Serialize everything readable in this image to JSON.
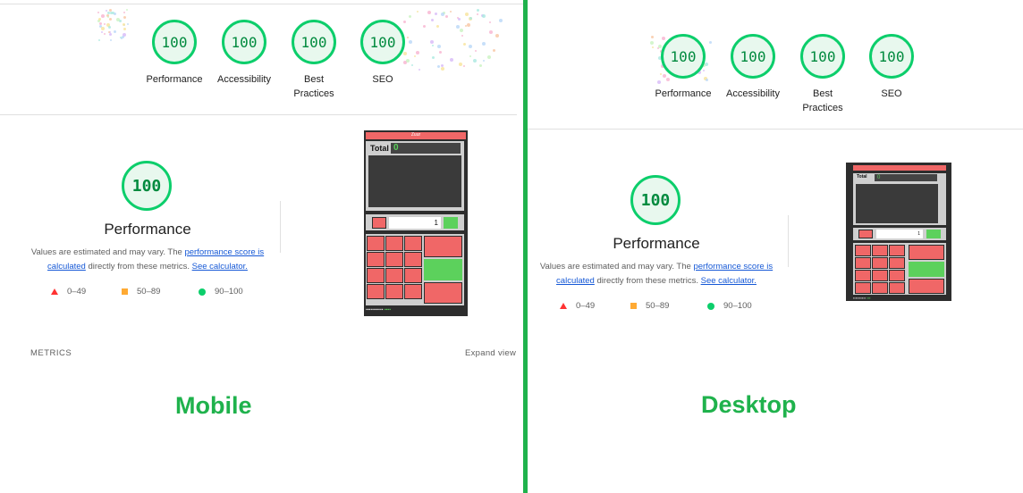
{
  "mobile": {
    "scores": [
      {
        "label": "Performance",
        "value": "100"
      },
      {
        "label": "Accessibility",
        "value": "100"
      },
      {
        "label": "Best Practices",
        "value": "100"
      },
      {
        "label": "SEO",
        "value": "100"
      }
    ],
    "main_score": "100",
    "main_title": "Performance",
    "desc_prefix": "Values are estimated and may vary. The ",
    "desc_link1": "performance score is calculated",
    "desc_middle": " directly from these metrics. ",
    "desc_link2": "See calculator.",
    "legend": [
      "0–49",
      "50–89",
      "90–100"
    ],
    "metrics_label": "METRICS",
    "expand_label": "Expand view",
    "caption": "Mobile",
    "thumb": {
      "header": "Zuur",
      "total_label": "Total",
      "total_value": "0",
      "qty": "1"
    }
  },
  "desktop": {
    "scores": [
      {
        "label": "Performance",
        "value": "100"
      },
      {
        "label": "Accessibility",
        "value": "100"
      },
      {
        "label": "Best Practices",
        "value": "100"
      },
      {
        "label": "SEO",
        "value": "100"
      }
    ],
    "main_score": "100",
    "main_title": "Performance",
    "desc_prefix": "Values are estimated and may vary. The ",
    "desc_link1": "performance score is calculated",
    "desc_middle": " directly from these metrics. ",
    "desc_link2": "See calculator.",
    "legend": [
      "0–49",
      "50–89",
      "90–100"
    ],
    "caption": "Desktop",
    "thumb": {
      "total_label": "Total",
      "total_value": "0",
      "qty": "1"
    }
  },
  "colors": {
    "pass": "#0cce6b",
    "accent_green": "#1fb24c",
    "fail": "#ff3333",
    "average": "#ffaa33"
  }
}
